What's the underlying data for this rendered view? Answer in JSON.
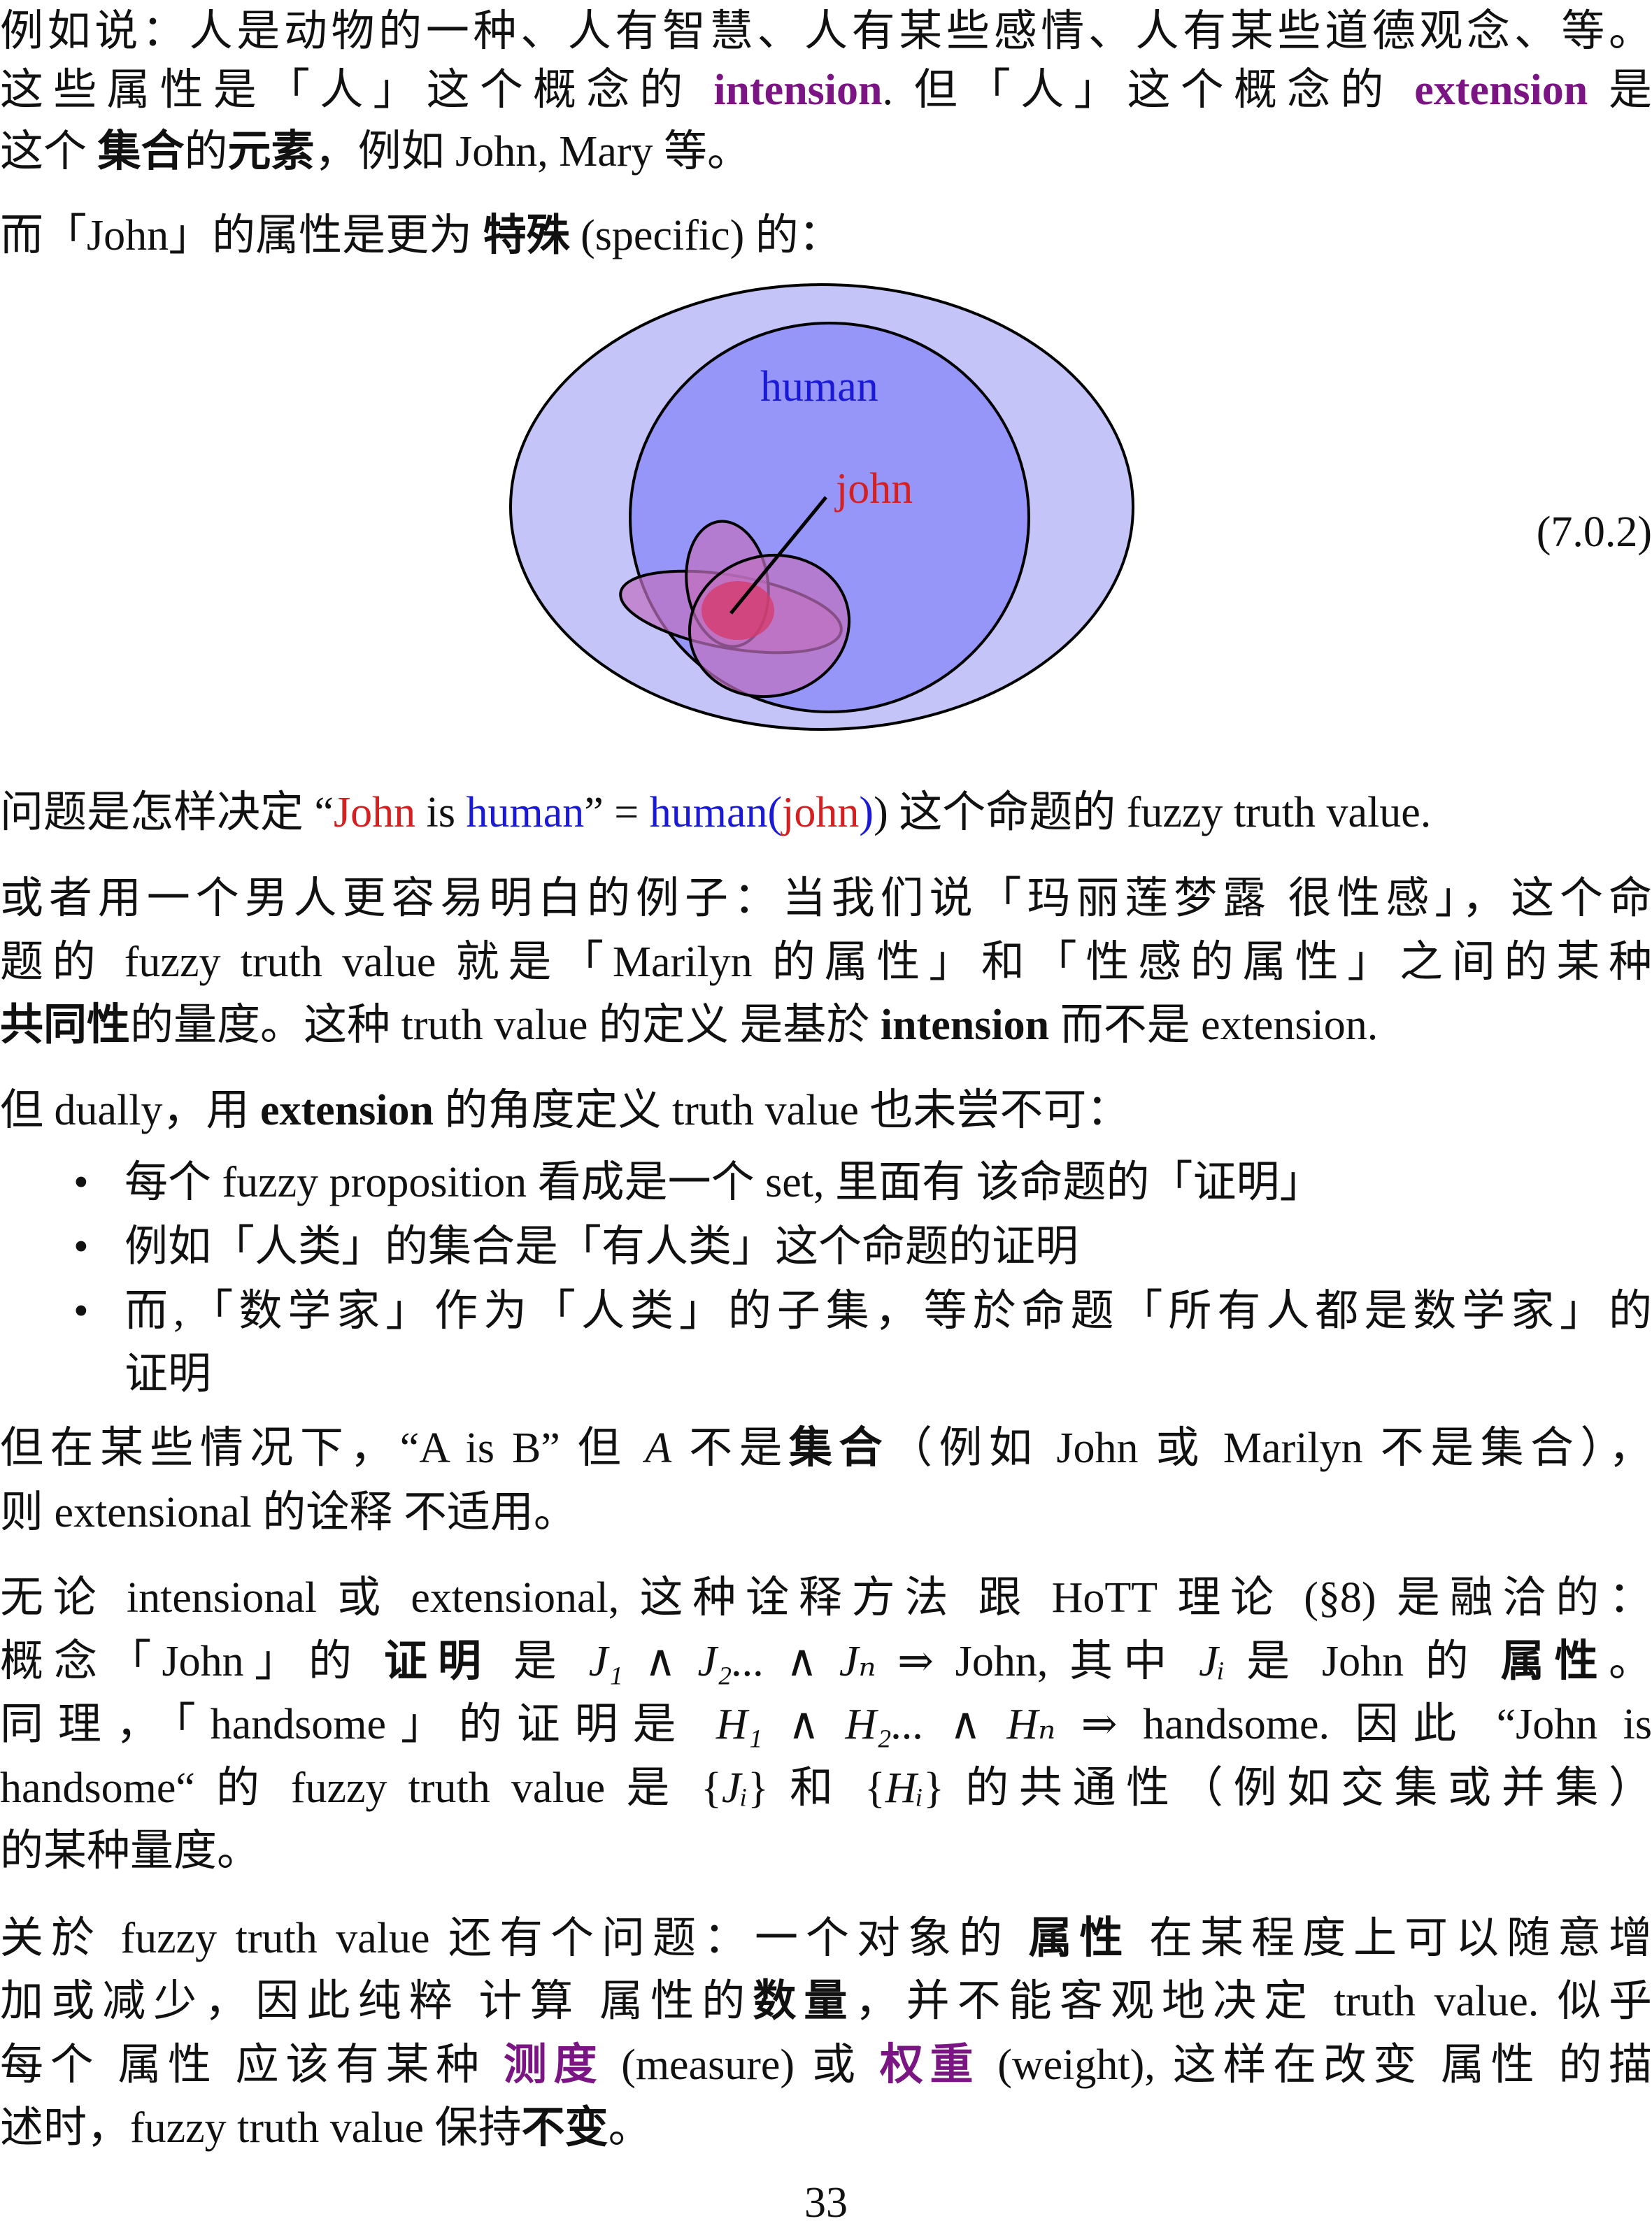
{
  "p1": {
    "l1": "例如说：人是动物的一种、人有智慧、人有某些感情、人有某些道德观念、等。",
    "l2a": "这些属性是「人」这个概念的 ",
    "l2b": "intension",
    "l2c": ". 但「人」这个概念的 ",
    "l2d": "extension",
    "l2e": " 是",
    "l3a": "这个 ",
    "l3b": "集合",
    "l3c": "的",
    "l3d": "元素",
    "l3e": "，例如 John, Mary 等。"
  },
  "p2": {
    "a": "而「John」的属性是更为 ",
    "b": "特殊",
    "c": " (specific) 的："
  },
  "figure": {
    "human_label": "human",
    "john_label": "john",
    "eq_number": "(7.0.2)",
    "colors": {
      "outer_fill": "#c4c4f8",
      "inner_fill": "#9696f8",
      "blob_fill": "#c070c0",
      "blob_center": "#d83868",
      "stroke": "#000000"
    }
  },
  "p3": {
    "a": "问题是怎样决定 “",
    "b": "John",
    "c": " is ",
    "d": "human",
    "e": "” = ",
    "f": "human",
    "g": "(",
    "h": "john",
    "i": ") 这个命题的 fuzzy truth value."
  },
  "p4": {
    "l1": "或者用一个男人更容易明白的例子：当我们说「玛丽莲梦露 很性感」，这个命",
    "l2": "题的 fuzzy truth value 就是「Marilyn 的属性」和「性感的属性」之间的某种",
    "l3a": "共同性",
    "l3b": "的量度。这种 truth value 的定义 是基於 ",
    "l3c": "intension",
    "l3d": " 而不是 extension."
  },
  "p5": {
    "a": "但 dually，用 ",
    "b": "extension",
    "c": " 的角度定义 truth value 也未尝不可："
  },
  "bullets": {
    "dot": "•",
    "b1": "每个 fuzzy proposition 看成是一个 set, 里面有 该命题的「证明」",
    "b2": "例如「人类」的集合是「有人类」这个命题的证明",
    "b3l1": "而,「数学家」作为「人类」的子集，等於命题「所有人都是数学家」的",
    "b3l2": "证明"
  },
  "p6": {
    "l1a": "但在某些情况下，“A is B” 但 ",
    "l1b": "A",
    "l1c": " 不是",
    "l1d": "集合",
    "l1e": "（例如 John 或 Marilyn 不是集合），",
    "l2": "则 extensional 的诠释 不适用。"
  },
  "p7": {
    "l1": "无论 intensional 或 extensional, 这种诠释方法 跟 HoTT 理论 (§8) 是融洽的：",
    "l2a": "概念「John」的 ",
    "l2b": "证明",
    "l2c": " 是 ",
    "l2d": "J₁ ∧ J₂... ∧ Jₙ",
    "l2e": " ⇒ John, 其中 ",
    "l2f": "Jᵢ",
    "l2g": " 是 John 的 ",
    "l2h": "属性",
    "l2i": "。",
    "l3a": "同理，「handsome」的证明是 ",
    "l3b": "H₁ ∧ H₂... ∧ Hₙ",
    "l3c": " ⇒ handsome. 因此 “John is",
    "l4a": "handsome“ 的 fuzzy truth value 是 {",
    "l4b": "Jᵢ",
    "l4c": "} 和 {",
    "l4d": "Hᵢ",
    "l4e": "} 的共通性（例如交集或并集）",
    "l5": "的某种量度。"
  },
  "p8": {
    "l1a": "关於 fuzzy truth value 还有个问题：一个对象的 ",
    "l1b": "属性",
    "l1c": " 在某程度上可以随意增",
    "l2a": "加或减少，因此纯粹 计算 属性的",
    "l2b": "数量",
    "l2c": "，并不能客观地决定 truth value. 似乎",
    "l3a": "每个 属性 应该有某种 ",
    "l3b": "测度",
    "l3c": " (measure) 或 ",
    "l3d": "权重",
    "l3e": " (weight), 这样在改变 属性 的描",
    "l4a": "述时，fuzzy truth value 保持",
    "l4b": "不变",
    "l4c": "。"
  },
  "page_number": "33"
}
